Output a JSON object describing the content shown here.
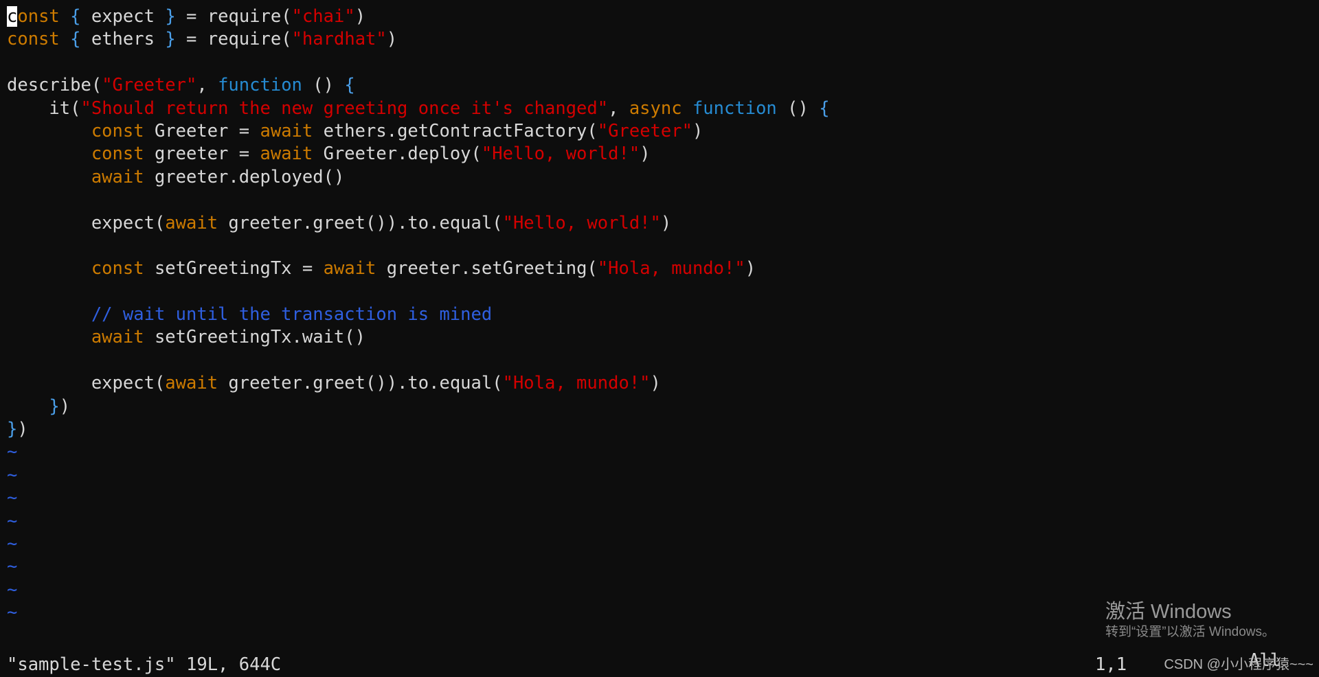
{
  "editor": {
    "name": "vim",
    "filename": "sample-test.js",
    "mode": "normal",
    "background_color": "#0d0d0d",
    "foreground_color": "#d8d8d8",
    "cursor": {
      "line": 1,
      "column": 1,
      "char": "c"
    },
    "total_lines": 19,
    "lines": [
      {
        "n": 1,
        "tokens": [
          {
            "t": "const",
            "c": "keyword",
            "cursor": true
          },
          {
            "t": " ",
            "c": "plain"
          },
          {
            "t": "{",
            "c": "brace"
          },
          {
            "t": " expect ",
            "c": "plain"
          },
          {
            "t": "}",
            "c": "brace"
          },
          {
            "t": " ",
            "c": "plain"
          },
          {
            "t": "=",
            "c": "op"
          },
          {
            "t": " require",
            "c": "plain"
          },
          {
            "t": "(",
            "c": "paren"
          },
          {
            "t": "\"chai\"",
            "c": "string"
          },
          {
            "t": ")",
            "c": "paren"
          }
        ]
      },
      {
        "n": 2,
        "tokens": [
          {
            "t": "const",
            "c": "keyword"
          },
          {
            "t": " ",
            "c": "plain"
          },
          {
            "t": "{",
            "c": "brace"
          },
          {
            "t": " ethers ",
            "c": "plain"
          },
          {
            "t": "}",
            "c": "brace"
          },
          {
            "t": " ",
            "c": "plain"
          },
          {
            "t": "=",
            "c": "op"
          },
          {
            "t": " require",
            "c": "plain"
          },
          {
            "t": "(",
            "c": "paren"
          },
          {
            "t": "\"hardhat\"",
            "c": "string"
          },
          {
            "t": ")",
            "c": "paren"
          }
        ]
      },
      {
        "n": 3,
        "tokens": []
      },
      {
        "n": 4,
        "tokens": [
          {
            "t": "describe",
            "c": "plain"
          },
          {
            "t": "(",
            "c": "paren"
          },
          {
            "t": "\"Greeter\"",
            "c": "string"
          },
          {
            "t": ",",
            "c": "op"
          },
          {
            "t": " ",
            "c": "plain"
          },
          {
            "t": "function",
            "c": "function"
          },
          {
            "t": " ",
            "c": "plain"
          },
          {
            "t": "()",
            "c": "paren"
          },
          {
            "t": " ",
            "c": "plain"
          },
          {
            "t": "{",
            "c": "brace"
          }
        ]
      },
      {
        "n": 5,
        "tokens": [
          {
            "t": "    it",
            "c": "plain"
          },
          {
            "t": "(",
            "c": "paren"
          },
          {
            "t": "\"Should return the new greeting once it's changed\"",
            "c": "string"
          },
          {
            "t": ",",
            "c": "op"
          },
          {
            "t": " ",
            "c": "plain"
          },
          {
            "t": "async",
            "c": "keyword"
          },
          {
            "t": " ",
            "c": "plain"
          },
          {
            "t": "function",
            "c": "function"
          },
          {
            "t": " ",
            "c": "plain"
          },
          {
            "t": "()",
            "c": "paren"
          },
          {
            "t": " ",
            "c": "plain"
          },
          {
            "t": "{",
            "c": "brace"
          }
        ]
      },
      {
        "n": 6,
        "tokens": [
          {
            "t": "        ",
            "c": "plain"
          },
          {
            "t": "const",
            "c": "keyword"
          },
          {
            "t": " Greeter ",
            "c": "plain"
          },
          {
            "t": "=",
            "c": "op"
          },
          {
            "t": " ",
            "c": "plain"
          },
          {
            "t": "await",
            "c": "keyword"
          },
          {
            "t": " ethers.getContractFactory",
            "c": "plain"
          },
          {
            "t": "(",
            "c": "paren"
          },
          {
            "t": "\"Greeter\"",
            "c": "string"
          },
          {
            "t": ")",
            "c": "paren"
          }
        ]
      },
      {
        "n": 7,
        "tokens": [
          {
            "t": "        ",
            "c": "plain"
          },
          {
            "t": "const",
            "c": "keyword"
          },
          {
            "t": " greeter ",
            "c": "plain"
          },
          {
            "t": "=",
            "c": "op"
          },
          {
            "t": " ",
            "c": "plain"
          },
          {
            "t": "await",
            "c": "keyword"
          },
          {
            "t": " Greeter.deploy",
            "c": "plain"
          },
          {
            "t": "(",
            "c": "paren"
          },
          {
            "t": "\"Hello, world!\"",
            "c": "string"
          },
          {
            "t": ")",
            "c": "paren"
          }
        ]
      },
      {
        "n": 8,
        "tokens": [
          {
            "t": "        ",
            "c": "plain"
          },
          {
            "t": "await",
            "c": "keyword"
          },
          {
            "t": " greeter.deployed",
            "c": "plain"
          },
          {
            "t": "()",
            "c": "paren"
          }
        ]
      },
      {
        "n": 9,
        "tokens": []
      },
      {
        "n": 10,
        "tokens": [
          {
            "t": "        expect",
            "c": "plain"
          },
          {
            "t": "(",
            "c": "paren"
          },
          {
            "t": "await",
            "c": "keyword"
          },
          {
            "t": " greeter.greet",
            "c": "plain"
          },
          {
            "t": "())",
            "c": "paren"
          },
          {
            "t": ".to.equal",
            "c": "plain"
          },
          {
            "t": "(",
            "c": "paren"
          },
          {
            "t": "\"Hello, world!\"",
            "c": "string"
          },
          {
            "t": ")",
            "c": "paren"
          }
        ]
      },
      {
        "n": 11,
        "tokens": []
      },
      {
        "n": 12,
        "tokens": [
          {
            "t": "        ",
            "c": "plain"
          },
          {
            "t": "const",
            "c": "keyword"
          },
          {
            "t": " setGreetingTx ",
            "c": "plain"
          },
          {
            "t": "=",
            "c": "op"
          },
          {
            "t": " ",
            "c": "plain"
          },
          {
            "t": "await",
            "c": "keyword"
          },
          {
            "t": " greeter.setGreeting",
            "c": "plain"
          },
          {
            "t": "(",
            "c": "paren"
          },
          {
            "t": "\"Hola, mundo!\"",
            "c": "string"
          },
          {
            "t": ")",
            "c": "paren"
          }
        ]
      },
      {
        "n": 13,
        "tokens": []
      },
      {
        "n": 14,
        "tokens": [
          {
            "t": "        ",
            "c": "plain"
          },
          {
            "t": "// wait until the transaction is mined",
            "c": "comment"
          }
        ]
      },
      {
        "n": 15,
        "tokens": [
          {
            "t": "        ",
            "c": "plain"
          },
          {
            "t": "await",
            "c": "keyword"
          },
          {
            "t": " setGreetingTx.wait",
            "c": "plain"
          },
          {
            "t": "()",
            "c": "paren"
          }
        ]
      },
      {
        "n": 16,
        "tokens": []
      },
      {
        "n": 17,
        "tokens": [
          {
            "t": "        expect",
            "c": "plain"
          },
          {
            "t": "(",
            "c": "paren"
          },
          {
            "t": "await",
            "c": "keyword"
          },
          {
            "t": " greeter.greet",
            "c": "plain"
          },
          {
            "t": "())",
            "c": "paren"
          },
          {
            "t": ".to.equal",
            "c": "plain"
          },
          {
            "t": "(",
            "c": "paren"
          },
          {
            "t": "\"Hola, mundo!\"",
            "c": "string"
          },
          {
            "t": ")",
            "c": "paren"
          }
        ]
      },
      {
        "n": 18,
        "tokens": [
          {
            "t": "    ",
            "c": "plain"
          },
          {
            "t": "}",
            "c": "brace"
          },
          {
            "t": ")",
            "c": "paren"
          }
        ]
      },
      {
        "n": 19,
        "tokens": [
          {
            "t": "}",
            "c": "brace"
          },
          {
            "t": ")",
            "c": "paren"
          }
        ]
      }
    ],
    "empty_line_marker": "~",
    "empty_line_count": 8
  },
  "statusline": {
    "file_info": "\"sample-test.js\" 19L, 644C",
    "ruler": "1,1",
    "scroll": "All"
  },
  "watermark": {
    "title": "激活 Windows",
    "subtitle": "转到“设置”以激活 Windows。"
  },
  "csdn_watermark": {
    "text": "CSDN @小小程序猿~~~"
  }
}
